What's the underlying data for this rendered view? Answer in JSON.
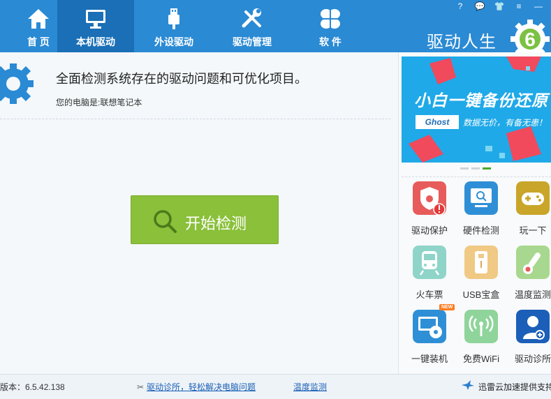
{
  "nav": {
    "tabs": [
      {
        "label": "首 页",
        "icon": "home-icon"
      },
      {
        "label": "本机驱动",
        "icon": "monitor-icon"
      },
      {
        "label": "外设驱动",
        "icon": "usb-icon"
      },
      {
        "label": "驱动管理",
        "icon": "tools-icon"
      },
      {
        "label": "软 件",
        "icon": "apps-icon"
      }
    ],
    "active_index": 1,
    "window_controls": [
      "?",
      "💬",
      "👕",
      "≡",
      "—"
    ],
    "brand": "驱动人生",
    "logo_digit": "6"
  },
  "main": {
    "headline": "全面检测系统存在的驱动问题和可优化项目。",
    "device_line": "您的电脑是:联想笔记本",
    "start_button": "开始检测"
  },
  "banner": {
    "title": "小白一键备份还原",
    "ghost_label": "Ghost",
    "tagline": "数据无价，有备无患！",
    "slide_count": 3,
    "active_slide": 3
  },
  "tools": [
    {
      "label": "驱动保护",
      "icon": "shield-warning-icon",
      "color": "#e85b5b"
    },
    {
      "label": "硬件检测",
      "icon": "monitor-search-icon",
      "color": "#2f8fd6"
    },
    {
      "label": "玩一下",
      "icon": "gamepad-icon",
      "color": "#c9a52a"
    },
    {
      "label": "火车票",
      "icon": "train-icon",
      "color": "#8fd4c9"
    },
    {
      "label": "USB宝盒",
      "icon": "usb-box-icon",
      "color": "#f0c985"
    },
    {
      "label": "温度监测",
      "icon": "thermometer-icon",
      "color": "#a8d88f"
    },
    {
      "label": "一键装机",
      "icon": "disc-install-icon",
      "color": "#2f8fd6",
      "badge": "NEW"
    },
    {
      "label": "免费WiFi",
      "icon": "wifi-icon",
      "color": "#8fd49a"
    },
    {
      "label": "驱动诊所",
      "icon": "doctor-icon",
      "color": "#1b5fb8"
    }
  ],
  "status": {
    "version": "版本：6.5.42.138",
    "clinic_link": "驱动诊所，轻松解决电脑问题",
    "temp_link": "温度监测",
    "accel": "迅雷云加速提供支持"
  },
  "colors": {
    "nav_bg": "#2a8ad4",
    "nav_active": "#1a6fb6",
    "start_green": "#8ac03a",
    "link_blue": "#1a5fb4"
  }
}
